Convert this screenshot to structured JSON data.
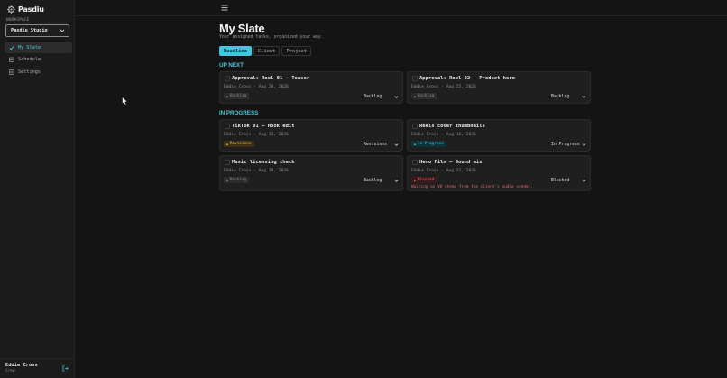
{
  "app": {
    "name": "Pasdiu"
  },
  "sidebar": {
    "workspace_label": "WORKSPACE",
    "workspace_value": "Pasdiu Studio",
    "items": [
      {
        "label": "My Slate",
        "icon": "check-icon",
        "active": true
      },
      {
        "label": "Schedule",
        "icon": "calendar-icon",
        "active": false
      },
      {
        "label": "Settings",
        "icon": "settings-icon",
        "active": false
      }
    ],
    "user": {
      "name": "Eddie Cross",
      "role": "Crew"
    }
  },
  "main": {
    "title": "My Slate",
    "subtitle": "Your assigned tasks, organized your way.",
    "tabs": [
      "Deadline",
      "Client",
      "Project"
    ],
    "active_tab": "Deadline",
    "sections": [
      {
        "label": "UP NEXT",
        "cards": [
          {
            "title": "Approval: Reel 01 — Teaser",
            "meta": "Eddie Cross · Aug 20, 2026",
            "badge": "Backlog",
            "status": "Backlog"
          },
          {
            "title": "Approval: Reel 02 — Product hero",
            "meta": "Eddie Cross · Aug 25, 2026",
            "badge": "Backlog",
            "status": "Backlog"
          }
        ]
      },
      {
        "label": "IN PROGRESS",
        "cards": [
          {
            "title": "TikTok 01 — Hook edit",
            "meta": "Eddie Cross · Aug 13, 2026",
            "badge": "Revisions",
            "status": "Revisions"
          },
          {
            "title": "Reels cover thumbnails",
            "meta": "Eddie Cross · Aug 16, 2026",
            "badge": "In Progress",
            "status": "In Progress"
          },
          {
            "title": "Music licensing check",
            "meta": "Eddie Cross · Aug 19, 2026",
            "badge": "Backlog",
            "status": "Backlog"
          },
          {
            "title": "Hero Film — Sound mix",
            "meta": "Eddie Cross · Aug 21, 2026",
            "badge": "Blocked",
            "status": "Blocked",
            "note": "Waiting on VO stems from the client's audio vendor."
          }
        ]
      }
    ]
  },
  "colors": {
    "accent": "#3ec7df",
    "background": "#141414",
    "card": "#1f1f1f",
    "revisions": "#e6b24a",
    "blocked": "#e06a6a"
  }
}
